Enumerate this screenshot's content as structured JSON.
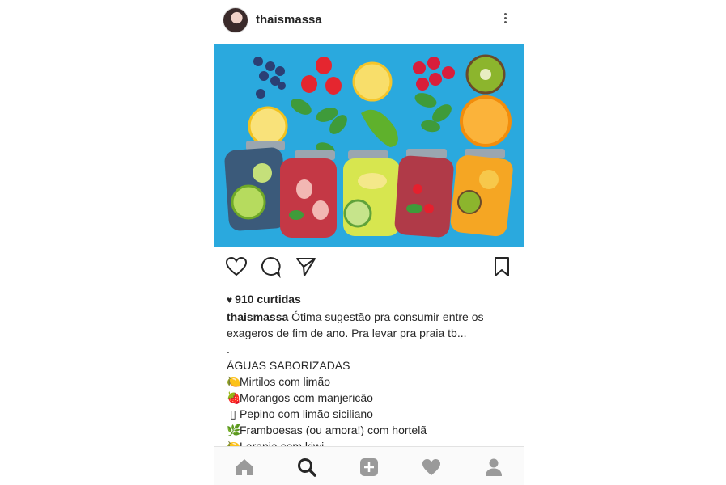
{
  "post": {
    "username": "thaismassa",
    "likes_text": "910 curtidas",
    "caption": {
      "username": "thaismassa",
      "text_line1": " Ótima sugestão pra consumir entre os",
      "text_line2": "exageros de fim de ano. Pra levar pra praia tb...",
      "dot_line": ".",
      "heading": "ÁGUAS SABORIZADAS",
      "items": [
        {
          "emoji": "🍋",
          "text": "Mirtilos com limão"
        },
        {
          "emoji": "🍓",
          "text": "Morangos com manjericão"
        },
        {
          "emoji": "▯",
          "text": "Pepino com limão siciliano"
        },
        {
          "emoji": "🌿",
          "text": "Framboesas (ou amora!) com hortelã"
        },
        {
          "emoji": "🍋",
          "text": "Laranja com kiwi"
        }
      ]
    }
  },
  "colors": {
    "photo_background": "#2aa9de",
    "accent_text": "#262626",
    "icon_gray": "#9a9a9a"
  },
  "icons": {
    "like": "heart-outline-icon",
    "comment": "comment-bubble-icon",
    "share": "paper-plane-icon",
    "save": "bookmark-icon",
    "nav": [
      "home-icon",
      "search-icon",
      "add-post-icon",
      "activity-heart-icon",
      "profile-icon"
    ]
  }
}
